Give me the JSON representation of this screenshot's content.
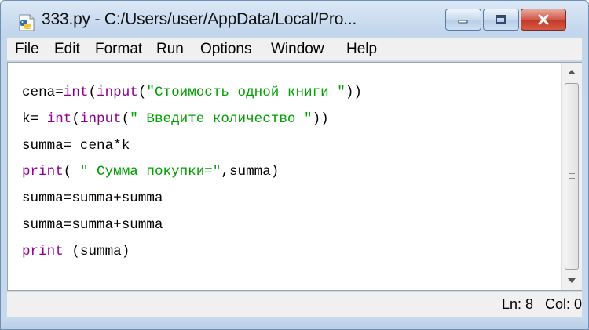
{
  "window": {
    "title": "333.py - C:/Users/user/AppData/Local/Pro...",
    "icons": {
      "app": "python-file-icon",
      "minimize": "minimize-icon",
      "maximize": "maximize-icon",
      "close": "close-icon"
    },
    "colors": {
      "close_button": "#c2382a",
      "keyword": "#900090",
      "string": "#00a000"
    }
  },
  "menu": {
    "file": {
      "label": "File"
    },
    "edit": {
      "label": "Edit"
    },
    "format": {
      "label": "Format"
    },
    "run": {
      "label": "Run"
    },
    "options": {
      "label": "Options"
    },
    "window": {
      "label": "Window"
    },
    "help": {
      "label": "Help"
    }
  },
  "editor": {
    "line1": {
      "a": "cena=",
      "b": "int",
      "c": "(",
      "d": "input",
      "e": "(",
      "f": "\"Стоимость одной книги \"",
      "g": "))"
    },
    "line2": {
      "a": "k= ",
      "b": "int",
      "c": "(",
      "d": "input",
      "e": "(",
      "f": "\" Введите количество \"",
      "g": "))"
    },
    "line3": {
      "a": "summa= cena*k"
    },
    "line4": {
      "a": "print",
      "b": "( ",
      "c": "\" Сумма покупки=\"",
      "d": ",summa)"
    },
    "line5": {
      "a": "summa=summa+summa"
    },
    "line6": {
      "a": "summa=summa+summa"
    },
    "line7": {
      "a": "print",
      "b": " (summa)"
    }
  },
  "status": {
    "text": "Ln: 8   Col: 0"
  }
}
